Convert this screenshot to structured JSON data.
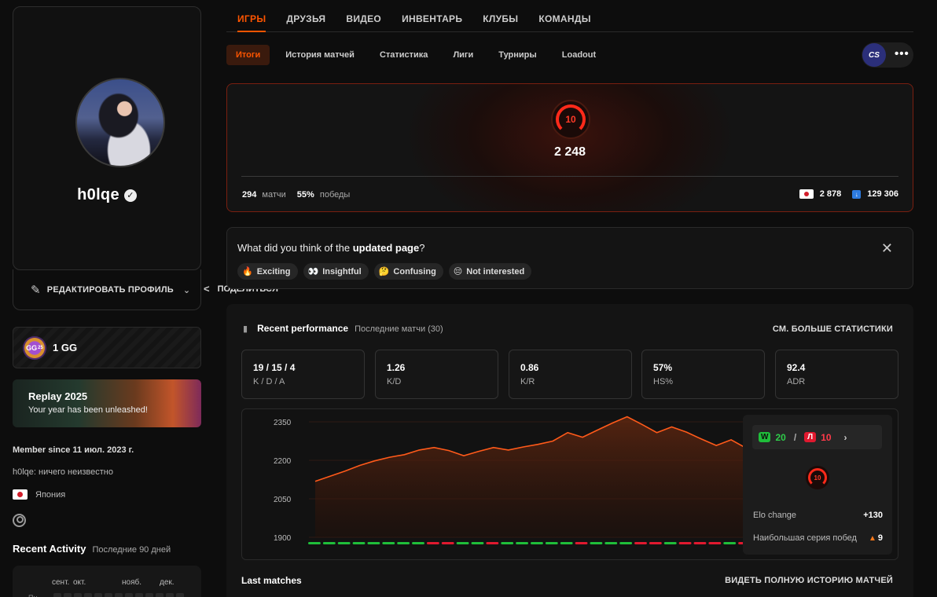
{
  "profile": {
    "username": "h0lqe",
    "edit_label": "РЕДАКТИРОВАТЬ ПРОФИЛЬ",
    "share_label": "ПОДЕЛИТЬСЯ",
    "gg_badge": "GG",
    "gg_badge_sub": "25",
    "gg_label": "1 GG",
    "replay_title": "Replay 2025",
    "replay_sub": "Your year has been unleashed!",
    "member_since": "Member since 11 июл. 2023 г.",
    "bio": "h0lqe: ничего неизвестно",
    "country": "Япония"
  },
  "activity": {
    "title": "Recent Activity",
    "subtitle": "Последние 90 дней",
    "months": [
      "сент.",
      "окт.",
      "нояб.",
      "дек."
    ],
    "day_label": "Пн"
  },
  "nav": {
    "tabs": [
      "ИГРЫ",
      "ДРУЗЬЯ",
      "ВИДЕО",
      "ИНВЕНТАРЬ",
      "КЛУБЫ",
      "КОМАНДЫ"
    ],
    "subtabs": [
      "Итоги",
      "История матчей",
      "Статистика",
      "Лиги",
      "Турниры",
      "Loadout"
    ],
    "game_badge": "CS",
    "more": "•••"
  },
  "elo": {
    "level": "10",
    "value": "2 248",
    "matches_value": "294",
    "matches_label": "матчи",
    "wins_value": "55%",
    "wins_label": "победы",
    "country_rank": "2 878",
    "global_rank": "129 306"
  },
  "feedback": {
    "question_start": "What did you think of the",
    "question_bold": "updated page",
    "question_end": "?",
    "chips": [
      {
        "icon": "🔥",
        "label": "Exciting"
      },
      {
        "icon": "👀",
        "label": "Insightful"
      },
      {
        "icon": "🤔",
        "label": "Confusing"
      },
      {
        "icon": "😔",
        "label": "Not interested"
      }
    ]
  },
  "performance": {
    "title": "Recent performance",
    "subtitle": "Последние матчи (30)",
    "more_stats": "СМ. БОЛЬШЕ СТАТИСТИКИ",
    "stats": [
      {
        "value": "19 / 15 / 4",
        "label": "K / D / A"
      },
      {
        "value": "1.26",
        "label": "K/D"
      },
      {
        "value": "0.86",
        "label": "K/R"
      },
      {
        "value": "57%",
        "label": "HS%"
      },
      {
        "value": "92.4",
        "label": "ADR"
      }
    ],
    "wins_badge": "W",
    "wins": "20",
    "losses_badge": "Л",
    "losses": "10",
    "mini_level": "10",
    "elo_change_label": "Elo change",
    "elo_change_value": "+130",
    "streak_label": "Наибольшая серия побед",
    "streak_value": "9",
    "last_matches": "Last matches",
    "full_history": "ВИДЕТЬ ПОЛНУЮ ИСТОРИЮ МАТЧЕЙ"
  },
  "colors": {
    "accent": "#ff5500",
    "win": "#1fbe3a",
    "loss": "#e0192f",
    "line": "#ff5a1a"
  },
  "chart_data": {
    "type": "line",
    "y_ticks": [
      2350,
      2200,
      2050,
      1900
    ],
    "ylim": [
      1900,
      2350
    ],
    "values": [
      2118,
      2138,
      2158,
      2180,
      2198,
      2212,
      2222,
      2240,
      2250,
      2238,
      2218,
      2235,
      2250,
      2240,
      2252,
      2262,
      2275,
      2308,
      2290,
      2318,
      2345,
      2370,
      2340,
      2308,
      2330,
      2310,
      2283,
      2258,
      2280,
      2248
    ],
    "results": [
      "W",
      "W",
      "W",
      "W",
      "W",
      "W",
      "W",
      "W",
      "L",
      "L",
      "W",
      "W",
      "L",
      "W",
      "W",
      "W",
      "W",
      "W",
      "L",
      "W",
      "W",
      "W",
      "L",
      "L",
      "W",
      "L",
      "L",
      "L",
      "W",
      "L"
    ]
  }
}
